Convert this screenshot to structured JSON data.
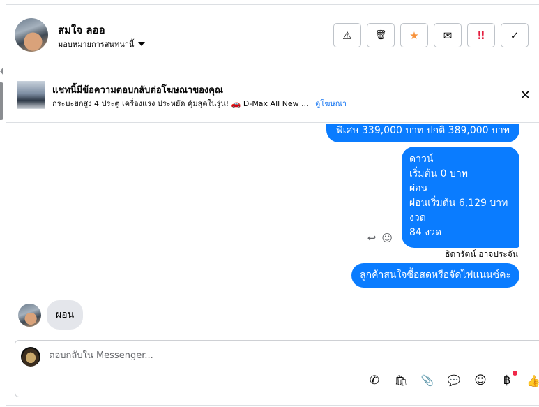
{
  "header": {
    "contact_name": "สมใจ ลออ",
    "assign_label": "มอบหมายการสนทนานี้",
    "actions": [
      {
        "name": "report-button",
        "icon": "⚠"
      },
      {
        "name": "delete-button",
        "icon": "🗑"
      },
      {
        "name": "star-button",
        "icon": "★"
      },
      {
        "name": "mail-button",
        "icon": "✉"
      },
      {
        "name": "priority-button",
        "icon": "‼"
      },
      {
        "name": "done-button",
        "icon": "✓"
      }
    ],
    "colors": {
      "star": "#f7923b",
      "priority": "#e41e3f"
    }
  },
  "ad_banner": {
    "title": "แชทนี้มีข้อความตอบกลับต่อโฆษณาของคุณ",
    "subtitle": "กระบะยกสูง 4 ประตู เครื่องแรง ประหยัด คุ้มสุดในรุ่น! 🚗 D-Max All New ...",
    "link": "ดูโฆษณา",
    "close": "✕"
  },
  "messages": {
    "out_1": "พิเศษ 339,000 บาท  ปกติ 389,000 บาท",
    "out_2": "ดาวน์\nเริ่มต้น 0 บาท\nผ่อน\nผ่อนเริ่มต้น 6,129 บาท\nงวด\n84 งวด",
    "sender_name": "ธิดารัตน์ อาจประจัน",
    "out_3": "ลูกค้าสนใจซื้อสดหรือจัดไฟแนนซ์คะ",
    "in_1": "ผอน",
    "reply_icon": "↩",
    "react_icon": "☺"
  },
  "composer": {
    "placeholder": "ตอบกลับใน Messenger...",
    "tools": [
      {
        "name": "call-icon",
        "glyph": "✆"
      },
      {
        "name": "shop-icon",
        "glyph": "🛍"
      },
      {
        "name": "attach-icon",
        "glyph": "📎"
      },
      {
        "name": "saved-reply-icon",
        "glyph": "💬"
      },
      {
        "name": "emoji-icon",
        "glyph": "☺"
      },
      {
        "name": "baht-icon",
        "glyph": "฿"
      },
      {
        "name": "like-icon",
        "glyph": "👍"
      }
    ]
  },
  "colors": {
    "accent": "#0a7cff",
    "link": "#1877f2",
    "bubble_in": "#e4e6eb"
  }
}
